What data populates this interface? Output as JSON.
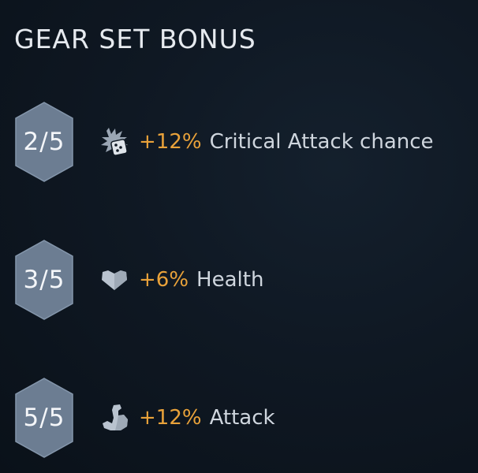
{
  "panel": {
    "title": "GEAR SET BONUS"
  },
  "tiers": [
    {
      "pieces": "2/5",
      "icon": "critical-dice-icon",
      "value": "+12%",
      "stat": "Critical Attack chance"
    },
    {
      "pieces": "3/5",
      "icon": "heart-icon",
      "value": "+6%",
      "stat": "Health"
    },
    {
      "pieces": "5/5",
      "icon": "flexed-arm-icon",
      "value": "+12%",
      "stat": "Attack"
    }
  ],
  "colors": {
    "accent": "#e9a23a",
    "hex_fill": "#6c7d92",
    "text": "#cfd6de"
  }
}
